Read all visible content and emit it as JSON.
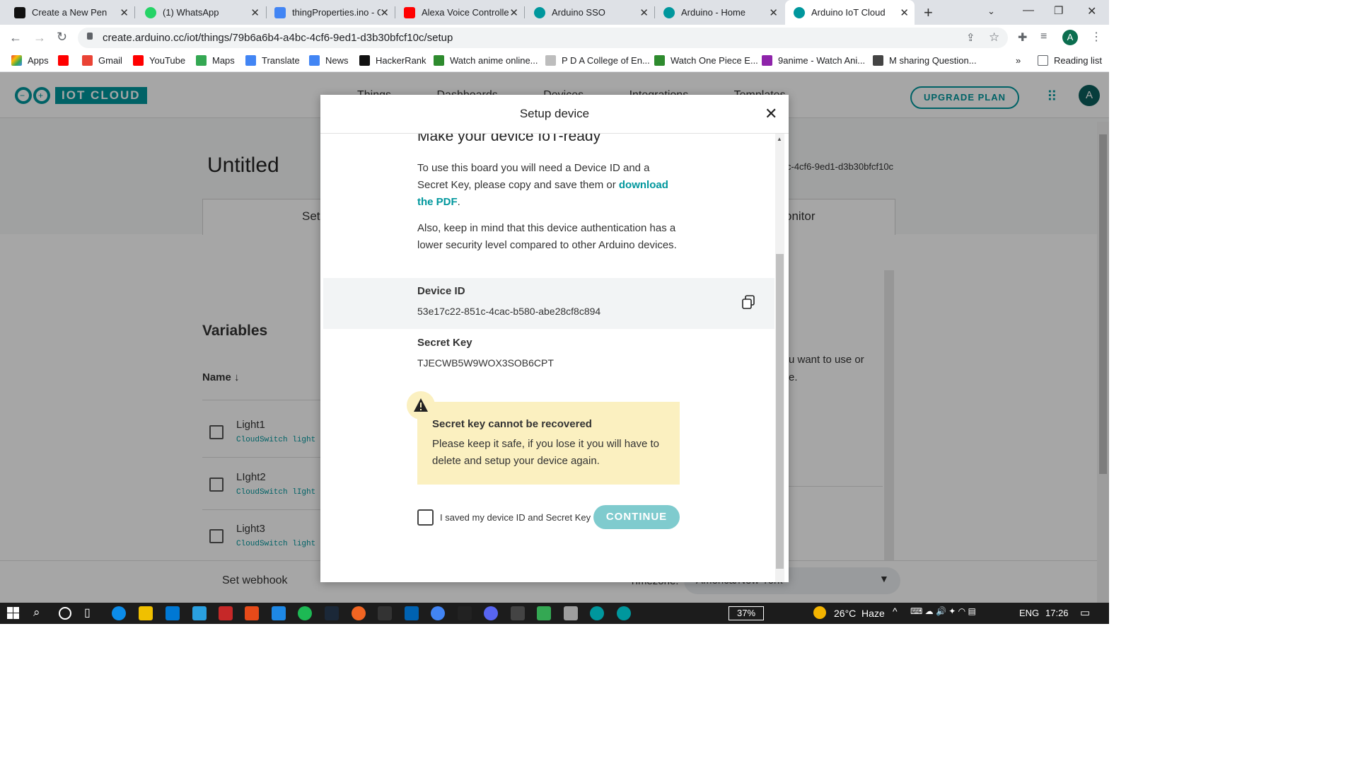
{
  "browser": {
    "tabs": [
      {
        "title": "Create a New Pen",
        "color": "#111111"
      },
      {
        "title": "(1) WhatsApp",
        "color": "#25d366"
      },
      {
        "title": "thingProperties.ino - G",
        "color": "#4285f4"
      },
      {
        "title": "Alexa Voice Controlle",
        "color": "#ff0000"
      },
      {
        "title": "Arduino SSO",
        "color": "#00979d"
      },
      {
        "title": "Arduino - Home",
        "color": "#00979d"
      },
      {
        "title": "Arduino IoT Cloud",
        "color": "#00979d"
      }
    ],
    "url": "create.arduino.cc/iot/things/79b6a6b4-a4bc-4cf6-9ed1-d3b30bfcf10c/setup",
    "profile_initial": "A",
    "bookmarks": [
      {
        "label": "Apps",
        "color": "#4285f4"
      },
      {
        "label": "",
        "color": "#ff0000"
      },
      {
        "label": "Gmail",
        "color": "#ea4335"
      },
      {
        "label": "YouTube",
        "color": "#ff0000"
      },
      {
        "label": "Maps",
        "color": "#34a853"
      },
      {
        "label": "Translate",
        "color": "#4285f4"
      },
      {
        "label": "News",
        "color": "#4285f4"
      },
      {
        "label": "HackerRank",
        "color": "#111111"
      },
      {
        "label": "Watch anime online...",
        "color": "#2e8b2e"
      },
      {
        "label": "P D A College of En...",
        "color": "#9e9e9e"
      },
      {
        "label": "Watch One Piece E...",
        "color": "#2e8b2e"
      },
      {
        "label": "9anime - Watch Ani...",
        "color": "#8e24aa"
      },
      {
        "label": "M sharing Question...",
        "color": "#444444"
      }
    ],
    "bookmarks_more": "»",
    "reading_list": "Reading list"
  },
  "app": {
    "logo_text": "IOT CLOUD",
    "nav": [
      "Things",
      "Dashboards",
      "Devices",
      "Integrations",
      "Templates"
    ],
    "upgrade_label": "UPGRADE PLAN",
    "avatar_initial": "A",
    "thing_title": "Untitled",
    "thing_id_partial": "c-4cf6-9ed1-d3b30bfcf10c",
    "tab_setup_partial": "Set",
    "tab_monitor_partial": "onitor",
    "variables_heading": "Variables",
    "name_column": "Name",
    "variables": [
      {
        "name": "Light1",
        "type": "CloudSwitch light"
      },
      {
        "name": "LIght2",
        "type": "CloudSwitch lIght"
      },
      {
        "name": "Light3",
        "type": "CloudSwitch light"
      }
    ],
    "side_text_line1": "u want to use or",
    "side_text_line2": "e.",
    "set_webhook": "Set webhook",
    "timezone_label": "Timezone:",
    "timezone_value": "America/New York"
  },
  "modal": {
    "title": "Setup device",
    "heading": "Make your device IoT-ready",
    "para1_prefix": "To use this board you will need a Device ID and a Secret Key, please copy and save them or ",
    "para1_link": "download the PDF",
    "para1_suffix": ".",
    "para2": "Also, keep in mind that this device authentication has a lower security level compared to other Arduino devices.",
    "device_id_label": "Device ID",
    "device_id_value": "53e17c22-851c-4cac-b580-abe28cf8c894",
    "secret_key_label": "Secret Key",
    "secret_key_value": "TJECWB5W9WOX3SOB6CPT",
    "warning_title": "Secret key cannot be recovered",
    "warning_text": "Please keep it safe, if you lose it you will have to delete and setup your device again.",
    "checkbox_label": "I saved my device ID and Secret Key",
    "continue_label": "CONTINUE",
    "accent_color": "#00979d",
    "warning_bg": "#fbf0c0"
  },
  "taskbar": {
    "battery": "37%",
    "weather": "26°C  Haze",
    "language": "ENG",
    "time": "17:26"
  }
}
